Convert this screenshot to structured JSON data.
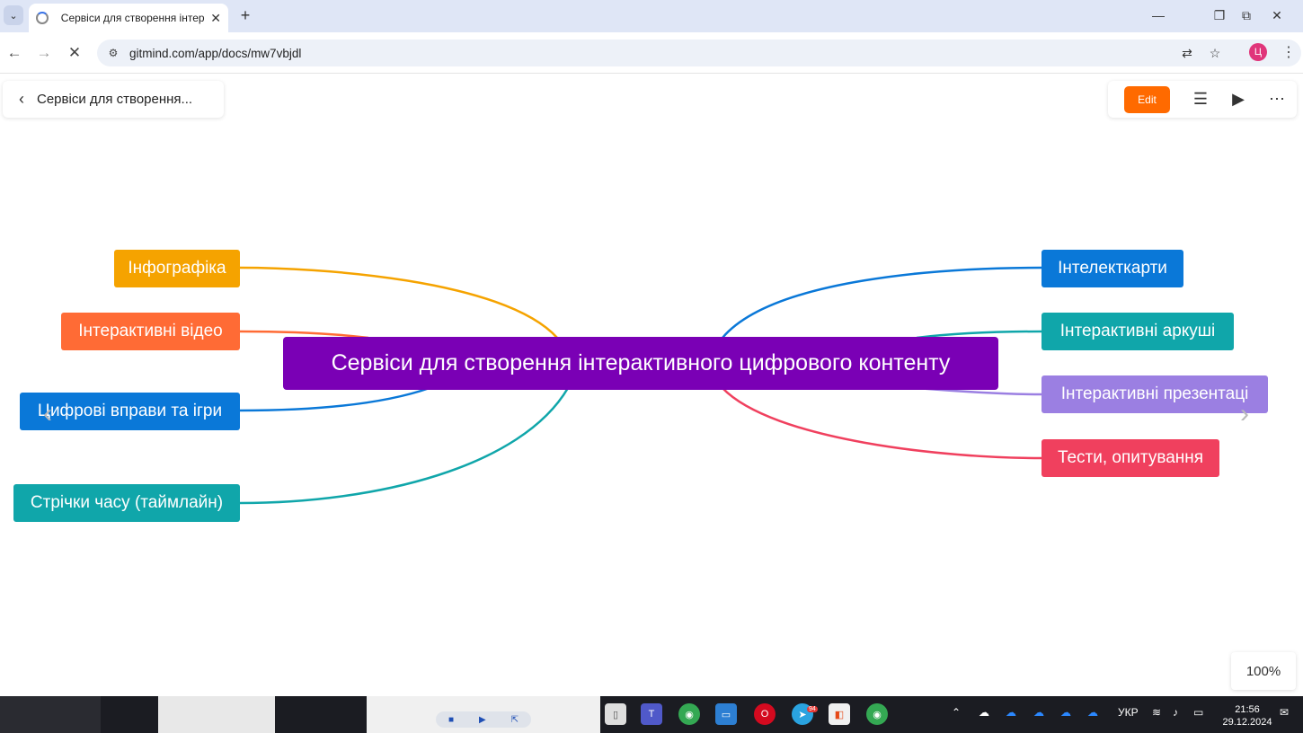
{
  "browser": {
    "tab_title": "Сервіси для створення інтера",
    "url": "gitmind.com/app/docs/mw7vbjdl",
    "profile_initial": "Ц",
    "icons": [
      "tab-search",
      "close",
      "new-tab",
      "back",
      "forward",
      "stop",
      "site-info",
      "translate",
      "star",
      "menu"
    ]
  },
  "header": {
    "doc_title": "Сервіси для створення...",
    "edit_label": "Edit"
  },
  "mindmap": {
    "root": "Сервіси для створення інтерактивного цифрового контенту",
    "root_color": "#7a00b5",
    "left": [
      {
        "label": "Інфографіка",
        "color": "#f5a300"
      },
      {
        "label": "Інтерактивні відео",
        "color": "#ff6b35"
      },
      {
        "label": "Цифрові вправи та ігри",
        "color": "#0a78d8"
      },
      {
        "label": "Стрічки часу (таймлайн)",
        "color": "#10a6aa"
      }
    ],
    "right": [
      {
        "label": "Інтелекткарти",
        "color": "#0a78d8"
      },
      {
        "label": "Інтерактивні аркуші",
        "color": "#10a6aa"
      },
      {
        "label": "Інтерактивні презентаці",
        "color": "#9b7fe2"
      },
      {
        "label": "Тести, опитування",
        "color": "#f0405e"
      }
    ]
  },
  "zoom": "100%",
  "taskbar": {
    "lang": "УКР",
    "time": "21:56",
    "date": "29.12.2024",
    "telegram_badge": "94"
  }
}
